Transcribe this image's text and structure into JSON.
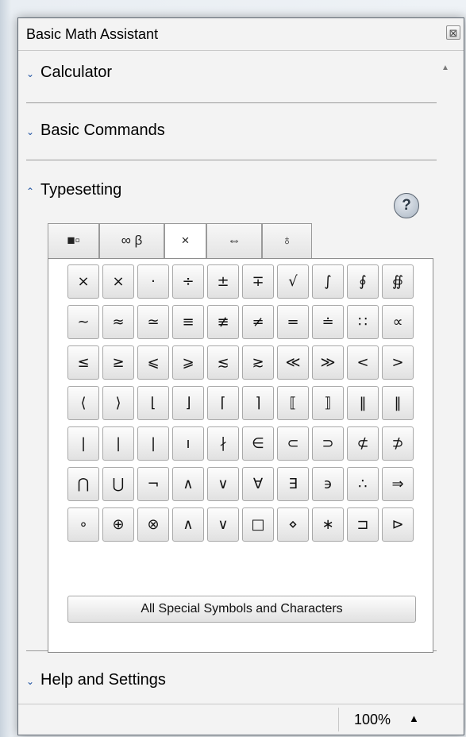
{
  "window": {
    "title": "Basic Math Assistant",
    "close_glyph": "⊠"
  },
  "sections": {
    "calculator": {
      "label": "Calculator",
      "chevron": "⌄"
    },
    "basic_commands": {
      "label": "Basic Commands",
      "chevron": "⌄"
    },
    "typesetting": {
      "label": "Typesetting",
      "chevron": "⌃"
    },
    "help_settings": {
      "label": "Help and Settings",
      "chevron": "⌄"
    }
  },
  "help_button": {
    "label": "?"
  },
  "tabs": [
    {
      "label": "■▫",
      "active": false
    },
    {
      "label": "∞ β",
      "active": false
    },
    {
      "label": "×",
      "active": true
    },
    {
      "label": "⇔",
      "active": false
    },
    {
      "label": "♁",
      "active": false
    }
  ],
  "symbols": [
    [
      "×",
      "×",
      "·",
      "÷",
      "±",
      "∓",
      "√",
      "∫",
      "∮",
      "∯"
    ],
    [
      "~",
      "≈",
      "≃",
      "≡",
      "≢",
      "≠",
      "=",
      "≐",
      "∷",
      "∝"
    ],
    [
      "≤",
      "≥",
      "⩽",
      "⩾",
      "≲",
      "≳",
      "≪",
      "≫",
      "<",
      ">"
    ],
    [
      "⟨",
      "⟩",
      "⌊",
      "⌋",
      "⌈",
      "⌉",
      "⟦",
      "⟧",
      "‖",
      "‖"
    ],
    [
      "|",
      "|",
      "|",
      "ı",
      "∤",
      "∈",
      "⊂",
      "⊃",
      "⊄",
      "⊅"
    ],
    [
      "⋂",
      "⋃",
      "¬",
      "∧",
      "∨",
      "∀",
      "∃",
      "϶",
      "∴",
      "⇒"
    ],
    [
      "∘",
      "⊕",
      "⊗",
      "∧",
      "∨",
      "□",
      "⋄",
      "∗",
      "⊐",
      "⊳"
    ]
  ],
  "all_symbols_button": {
    "label": "All Special Symbols and Characters"
  },
  "status": {
    "zoom": "100%",
    "zoom_arrow": "▲"
  },
  "scrollbar": {
    "up": "▲",
    "down": "▼"
  }
}
